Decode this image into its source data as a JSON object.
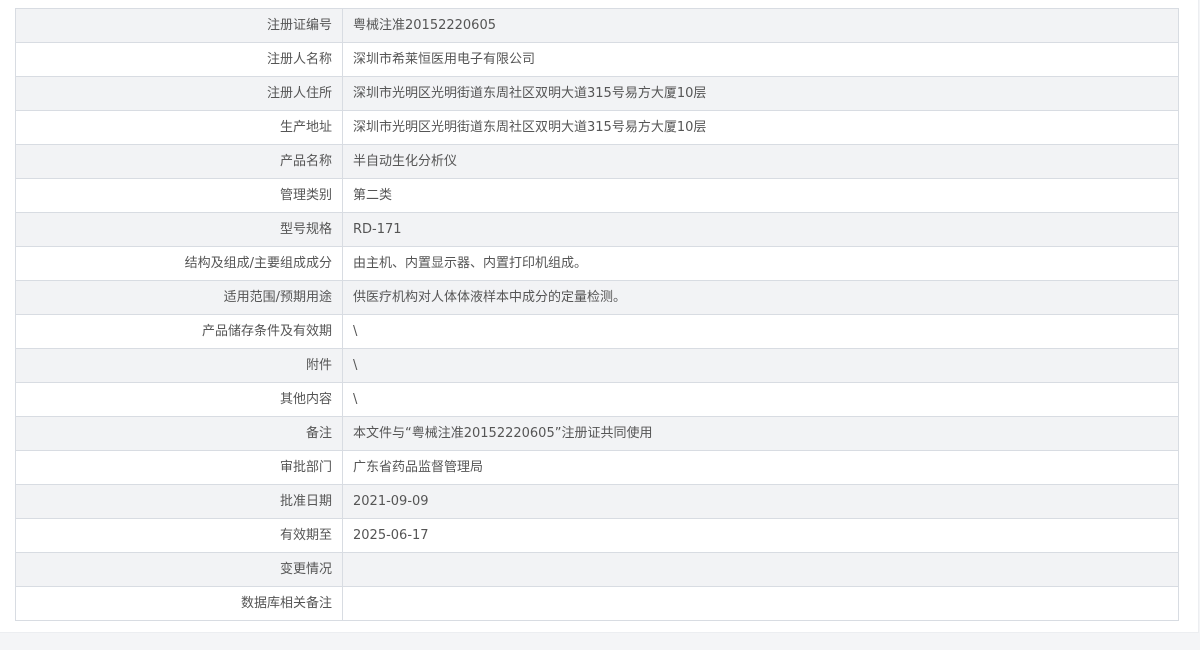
{
  "registration_detail": {
    "rows": [
      {
        "label": "注册证编号",
        "value": "粤械注准20152220605"
      },
      {
        "label": "注册人名称",
        "value": "深圳市希莱恒医用电子有限公司"
      },
      {
        "label": "注册人住所",
        "value": "深圳市光明区光明街道东周社区双明大道315号易方大厦10层"
      },
      {
        "label": "生产地址",
        "value": "深圳市光明区光明街道东周社区双明大道315号易方大厦10层"
      },
      {
        "label": "产品名称",
        "value": "半自动生化分析仪"
      },
      {
        "label": "管理类别",
        "value": "第二类"
      },
      {
        "label": "型号规格",
        "value": "RD-171"
      },
      {
        "label": "结构及组成/主要组成成分",
        "value": "由主机、内置显示器、内置打印机组成。"
      },
      {
        "label": "适用范围/预期用途",
        "value": "供医疗机构对人体体液样本中成分的定量检测。"
      },
      {
        "label": "产品储存条件及有效期",
        "value": "\\"
      },
      {
        "label": "附件",
        "value": "\\"
      },
      {
        "label": "其他内容",
        "value": "\\"
      },
      {
        "label": "备注",
        "value": "本文件与“粤械注准20152220605”注册证共同使用"
      },
      {
        "label": "审批部门",
        "value": "广东省药品监督管理局"
      },
      {
        "label": "批准日期",
        "value": "2021-09-09"
      },
      {
        "label": "有效期至",
        "value": "2025-06-17"
      },
      {
        "label": "变更情况",
        "value": ""
      },
      {
        "label": "数据库相关备注",
        "value": ""
      }
    ]
  },
  "colors": {
    "row_alt_background": "#f2f3f5",
    "border": "#d8dce2",
    "text": "#555555"
  }
}
